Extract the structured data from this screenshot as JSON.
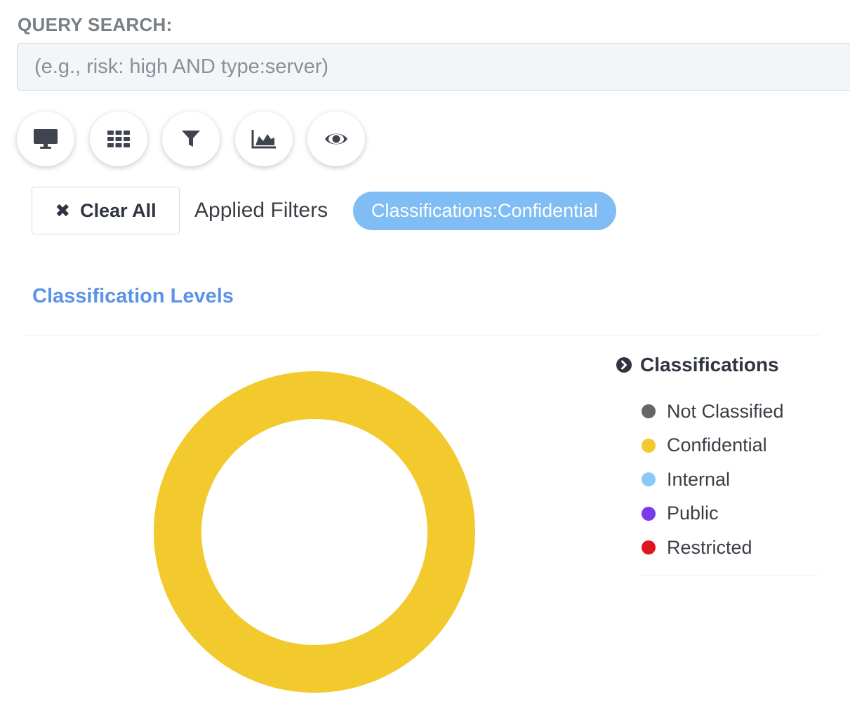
{
  "query": {
    "label": "QUERY SEARCH:",
    "placeholder": "(e.g., risk: high AND type:server)"
  },
  "toolbar": {
    "buttons": [
      {
        "icon": "monitor-icon"
      },
      {
        "icon": "grid-icon"
      },
      {
        "icon": "filter-icon"
      },
      {
        "icon": "area-chart-icon"
      },
      {
        "icon": "eye-icon"
      }
    ]
  },
  "filters": {
    "clear_label": "Clear All",
    "applied_label": "Applied Filters",
    "chips": [
      "Classifications:Confidential"
    ]
  },
  "section": {
    "title": "Classification Levels"
  },
  "chart_data": {
    "type": "pie",
    "style": "donut",
    "title": "",
    "legend_title": "Classifications",
    "legend_position": "right",
    "categories": [
      "Not Classified",
      "Confidential",
      "Internal",
      "Public",
      "Restricted"
    ],
    "values": [
      0,
      100,
      0,
      0,
      0
    ],
    "colors": [
      "#666666",
      "#f2ca2d",
      "#89c9f7",
      "#7c3aed",
      "#e0141e"
    ]
  }
}
